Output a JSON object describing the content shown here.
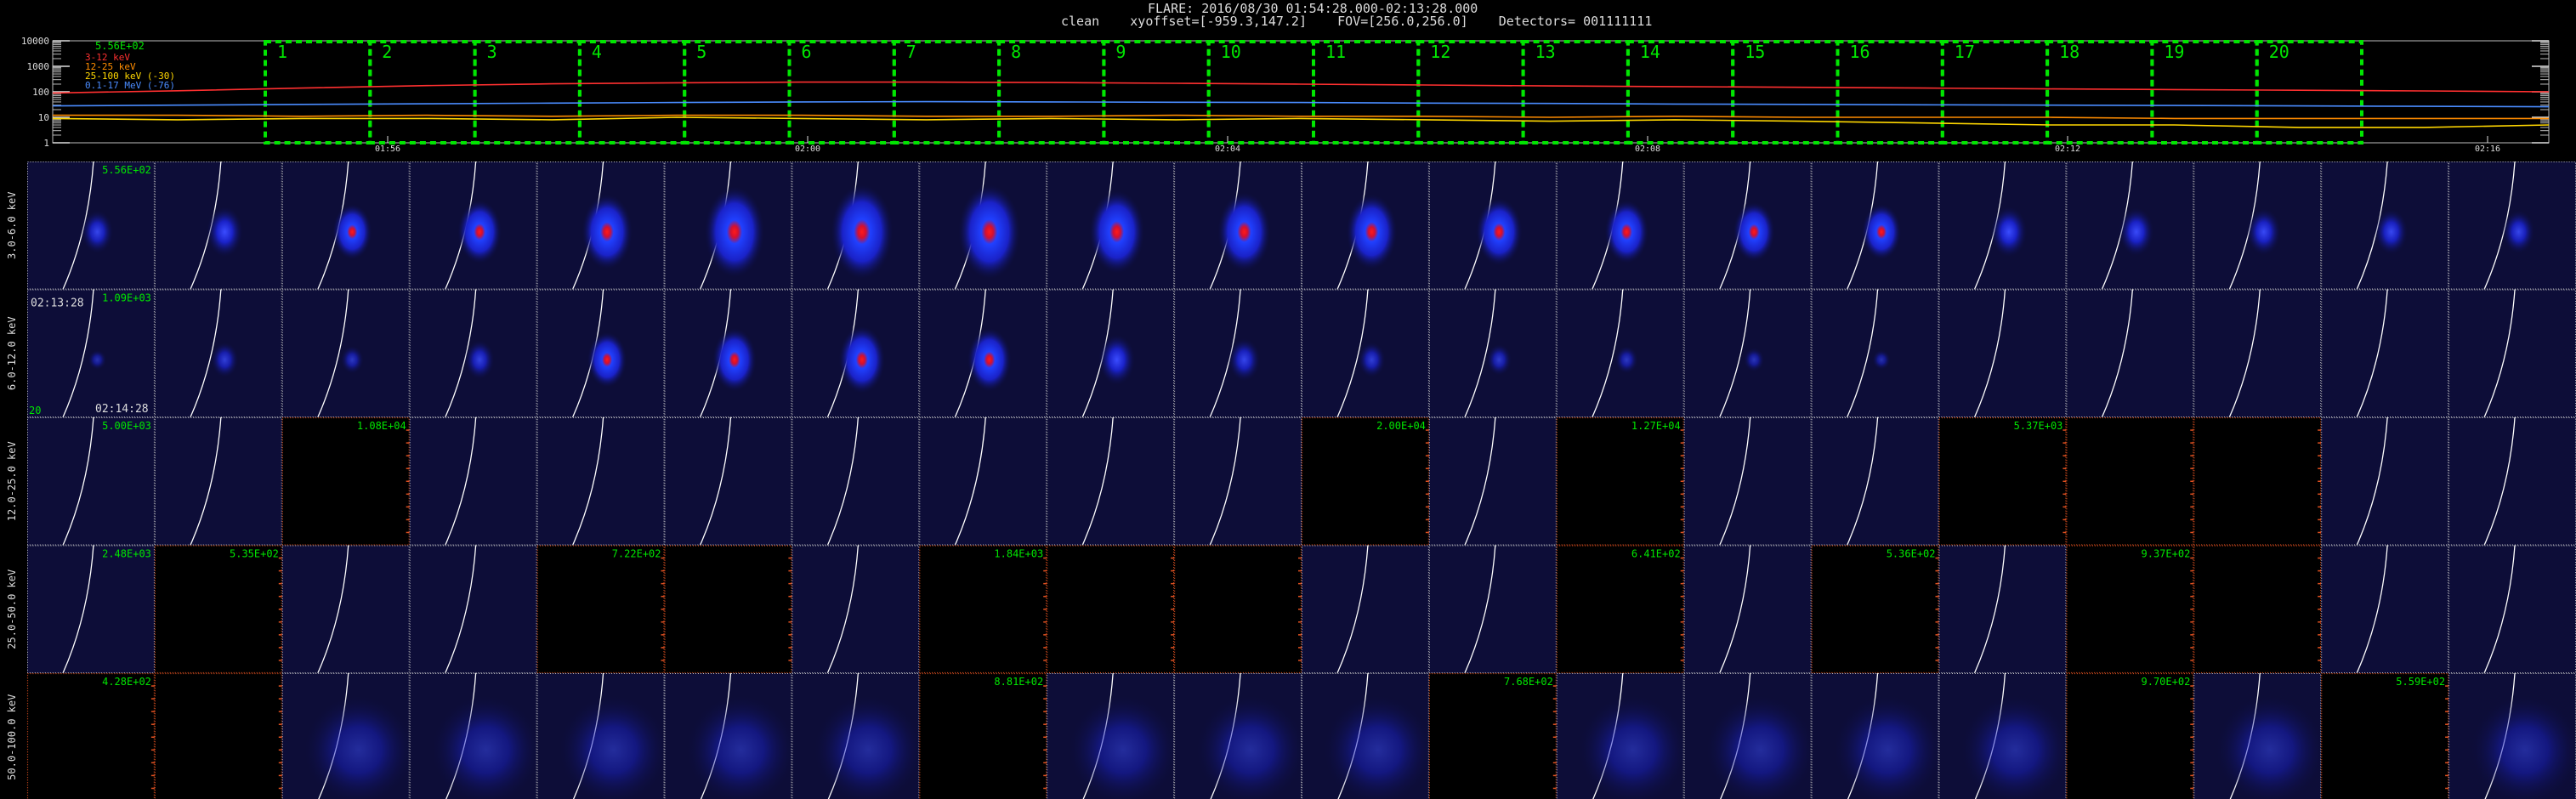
{
  "header": {
    "flare": "FLARE: 2016/08/30 01:54:28.000-02:13:28.000",
    "params": "clean    xyoffset=[-959.3,147.2]    FOV=[256.0,256.0]    Detectors= 001111111"
  },
  "colors": {
    "bg": "#000000",
    "frame": "#ffffff",
    "box": "#00e600",
    "empty_border": "#e05020",
    "label": "#00e600"
  },
  "chart_data": {
    "type": "line",
    "title": "",
    "yscale": "log",
    "ylim": [
      1,
      10000
    ],
    "y_ticks": [
      "1",
      "10",
      "100",
      "1000",
      "10000"
    ],
    "x_ticks": [
      "01:56",
      "02:00",
      "02:04",
      "02:08",
      "02:12",
      "02:16"
    ],
    "peak_label": "5.56E+02",
    "series": [
      {
        "name": "3-12 keV",
        "color": "#ff3030",
        "values": [
          90,
          110,
          140,
          175,
          205,
          225,
          240,
          240,
          230,
          215,
          200,
          185,
          170,
          160,
          150,
          140,
          130,
          122,
          115,
          108,
          100
        ]
      },
      {
        "name": "12-25 keV",
        "color": "#ff8c00",
        "values": [
          12,
          12,
          11,
          12,
          11,
          12,
          12,
          11,
          11,
          12,
          11,
          11,
          10,
          11,
          10,
          10,
          10,
          9,
          9,
          9,
          9
        ]
      },
      {
        "name": "25-100 keV (-30)",
        "color": "#ffd700",
        "values": [
          9,
          8,
          9,
          9,
          8,
          10,
          9,
          8,
          9,
          8,
          9,
          8,
          7,
          8,
          7,
          6,
          5,
          5,
          4,
          4,
          5
        ]
      },
      {
        "name": "0.1-17 MeV (-76)",
        "color": "#4a8cff",
        "values": [
          28,
          30,
          32,
          34,
          36,
          38,
          40,
          41,
          40,
          39,
          38,
          36,
          35,
          33,
          32,
          31,
          30,
          29,
          28,
          27,
          26
        ]
      }
    ],
    "intervals": [
      "1",
      "2",
      "3",
      "4",
      "5",
      "6",
      "7",
      "8",
      "9",
      "10",
      "11",
      "12",
      "13",
      "14",
      "15",
      "16",
      "17",
      "18",
      "19",
      "20"
    ]
  },
  "image_grid": {
    "rows": [
      {
        "label": "3.0-6.0 keV",
        "intensity": [
          0.35,
          0.45,
          0.5,
          0.6,
          0.75,
          0.95,
          1.0,
          1.0,
          0.85,
          0.8,
          0.75,
          0.65,
          0.6,
          0.55,
          0.5,
          0.45,
          0.42,
          0.4,
          0.38,
          0.35
        ],
        "cell_labels": [
          "5.56E+02",
          "",
          "",
          "",
          "",
          "",
          "",
          "",
          "",
          "",
          "",
          "",
          "",
          "",
          "",
          "",
          "",
          "",
          "",
          ""
        ],
        "empty": []
      },
      {
        "label": "6.0-12.0 keV",
        "intensity": [
          0.05,
          0.25,
          0.15,
          0.3,
          0.5,
          0.6,
          0.65,
          0.6,
          0.45,
          0.35,
          0.25,
          0.2,
          0.15,
          0.1,
          0.05,
          0.0,
          0.0,
          0.0,
          0.0,
          0.0
        ],
        "cell_labels": [
          "1.09E+03",
          "",
          "",
          "",
          "",
          "",
          "",
          "",
          "",
          "",
          "",
          "",
          "",
          "",
          "",
          "",
          "",
          "",
          "",
          ""
        ],
        "empty": [],
        "extra_text": [
          "02:13:28",
          "02:14:28",
          "20"
        ]
      },
      {
        "label": "12.0-25.0 keV",
        "intensity": [],
        "cell_labels": [
          "5.00E+03",
          "",
          "1.08E+04",
          "",
          "",
          "",
          "",
          "",
          "",
          "",
          "2.00E+04",
          "",
          "1.27E+04",
          "",
          "",
          "5.37E+03",
          "",
          "",
          "",
          ""
        ],
        "empty": [
          2,
          10,
          12,
          15,
          16,
          17
        ]
      },
      {
        "label": "25.0-50.0 keV",
        "intensity": [],
        "cell_labels": [
          "2.48E+03",
          "5.35E+02",
          "",
          "",
          "7.22E+02",
          "",
          "",
          "1.84E+03",
          "",
          "",
          "",
          "",
          "6.41E+02",
          "",
          "5.36E+02",
          "",
          "9.37E+02",
          "",
          "",
          ""
        ],
        "empty": [
          1,
          4,
          5,
          7,
          8,
          9,
          12,
          14,
          16,
          17
        ]
      },
      {
        "label": "50.0-100.0 keV",
        "intensity": [],
        "cell_labels": [
          "4.28E+02",
          "",
          "",
          "",
          "",
          "",
          "",
          "8.81E+02",
          "",
          "",
          "",
          "7.68E+02",
          "",
          "",
          "",
          "",
          "9.70E+02",
          "",
          "5.59E+02",
          ""
        ],
        "empty": [
          0,
          1,
          7,
          11,
          16,
          18
        ]
      }
    ]
  }
}
